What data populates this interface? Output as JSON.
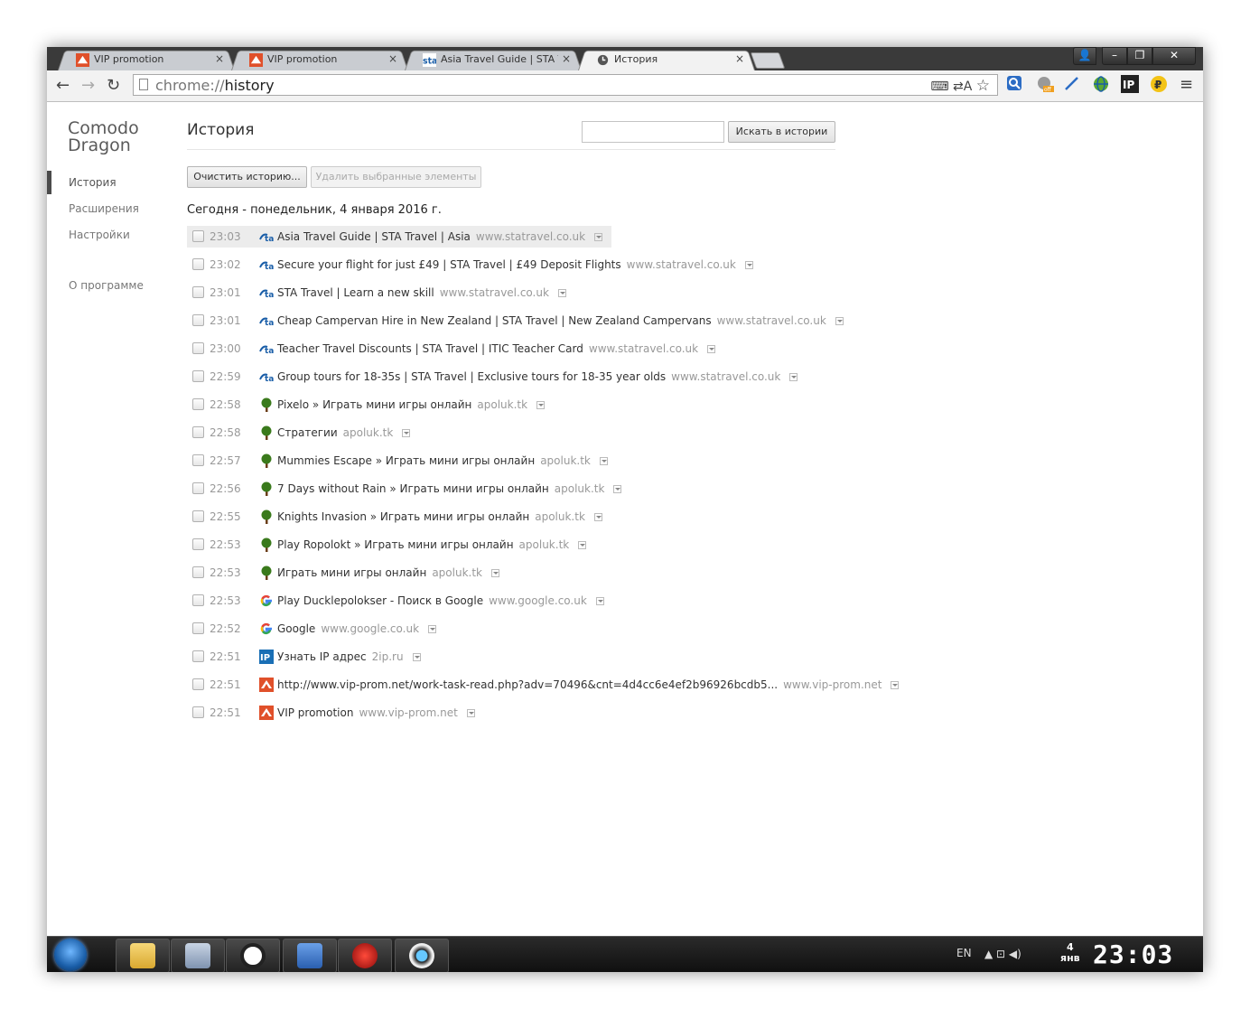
{
  "tabs": [
    {
      "title": "VIP promotion",
      "favicon": "vip-prom-icon",
      "close": "×"
    },
    {
      "title": "VIP promotion",
      "favicon": "vip-prom-icon",
      "close": "×"
    },
    {
      "title": "Asia Travel Guide | STA Trave",
      "favicon": "statravel-icon",
      "close": "×"
    },
    {
      "title": "История",
      "favicon": "history-clock-icon",
      "close": "×"
    }
  ],
  "window_controls": {
    "user": "👤",
    "minimize": "–",
    "maximize": "❐",
    "close": "✕"
  },
  "toolbar": {
    "back": "←",
    "forward": "→",
    "reload": "↻",
    "url_scheme": "chrome://",
    "url_path": "history",
    "translate": "⌨ ⇄A",
    "star": "☆",
    "menu": "≡"
  },
  "extensions": [
    "magnifier-icon",
    "cat-off-icon",
    "pen-icon",
    "globe-icon",
    "ip-icon",
    "ruble-icon"
  ],
  "sidebar": {
    "brand_line1": "Comodo",
    "brand_line2": "Dragon",
    "items": [
      {
        "label": "История",
        "active": true
      },
      {
        "label": "Расширения"
      },
      {
        "label": "Настройки"
      },
      {
        "label": "О программе"
      }
    ]
  },
  "main": {
    "title": "История",
    "search_placeholder": "",
    "search_button": "Искать в истории",
    "clear_button": "Очистить историю...",
    "delete_button": "Удалить выбранные элементы",
    "day_heading": "Сегодня - понедельник, 4 января 2016 г."
  },
  "history": [
    {
      "time": "23:03",
      "title": "Asia Travel Guide | STA Travel | Asia",
      "domain": "www.statravel.co.uk",
      "icon": "statravel"
    },
    {
      "time": "23:02",
      "title": "Secure your flight for just £49 | STA Travel | £49 Deposit Flights",
      "domain": "www.statravel.co.uk",
      "icon": "statravel"
    },
    {
      "time": "23:01",
      "title": "STA Travel | Learn a new skill",
      "domain": "www.statravel.co.uk",
      "icon": "statravel"
    },
    {
      "time": "23:01",
      "title": "Cheap Campervan Hire in New Zealand | STA Travel | New Zealand Campervans",
      "domain": "www.statravel.co.uk",
      "icon": "statravel"
    },
    {
      "time": "23:00",
      "title": "Teacher Travel Discounts | STA Travel | ITIC Teacher Card",
      "domain": "www.statravel.co.uk",
      "icon": "statravel"
    },
    {
      "time": "22:59",
      "title": "Group tours for 18-35s | STA Travel | Exclusive tours for 18-35 year olds",
      "domain": "www.statravel.co.uk",
      "icon": "statravel"
    },
    {
      "time": "22:58",
      "title": "Pixelo » Играть мини игры онлайн",
      "domain": "apoluk.tk",
      "icon": "tree"
    },
    {
      "time": "22:58",
      "title": "Стратегии",
      "domain": "apoluk.tk",
      "icon": "tree"
    },
    {
      "time": "22:57",
      "title": "Mummies Escape » Играть мини игры онлайн",
      "domain": "apoluk.tk",
      "icon": "tree"
    },
    {
      "time": "22:56",
      "title": "7 Days without Rain » Играть мини игры онлайн",
      "domain": "apoluk.tk",
      "icon": "tree"
    },
    {
      "time": "22:55",
      "title": "Knights Invasion » Играть мини игры онлайн",
      "domain": "apoluk.tk",
      "icon": "tree"
    },
    {
      "time": "22:53",
      "title": "Play Ropolokt » Играть мини игры онлайн",
      "domain": "apoluk.tk",
      "icon": "tree"
    },
    {
      "time": "22:53",
      "title": "Играть мини игры онлайн",
      "domain": "apoluk.tk",
      "icon": "tree"
    },
    {
      "time": "22:53",
      "title": "Play Ducklepolokser - Поиск в Google",
      "domain": "www.google.co.uk",
      "icon": "google"
    },
    {
      "time": "22:52",
      "title": "Google",
      "domain": "www.google.co.uk",
      "icon": "google"
    },
    {
      "time": "22:51",
      "title": "Узнать IP адрес",
      "domain": "2ip.ru",
      "icon": "ip"
    },
    {
      "time": "22:51",
      "title": "http://www.vip-prom.net/work-task-read.php?adv=70496&cnt=4d4cc6e4ef2b96926bcdb5...",
      "domain": "www.vip-prom.net",
      "icon": "vip"
    },
    {
      "time": "22:51",
      "title": "VIP promotion",
      "domain": "www.vip-prom.net",
      "icon": "vip"
    }
  ],
  "taskbar": {
    "apps": [
      "file-explorer-icon",
      "calculator-icon",
      "ccleaner-icon",
      "remote-desktop-icon",
      "red-app-icon",
      "camera-icon"
    ],
    "language": "EN",
    "tray_icons": "▲ ⊡ ◀)",
    "date_day": "4",
    "date_month": "янв",
    "clock": "23:03"
  },
  "colors": {
    "statravel": "#1a5ea8",
    "tree": "#3a7a1c",
    "google": "#4285f4",
    "ip": "#1a6fb5",
    "vip": "#e0502a"
  }
}
